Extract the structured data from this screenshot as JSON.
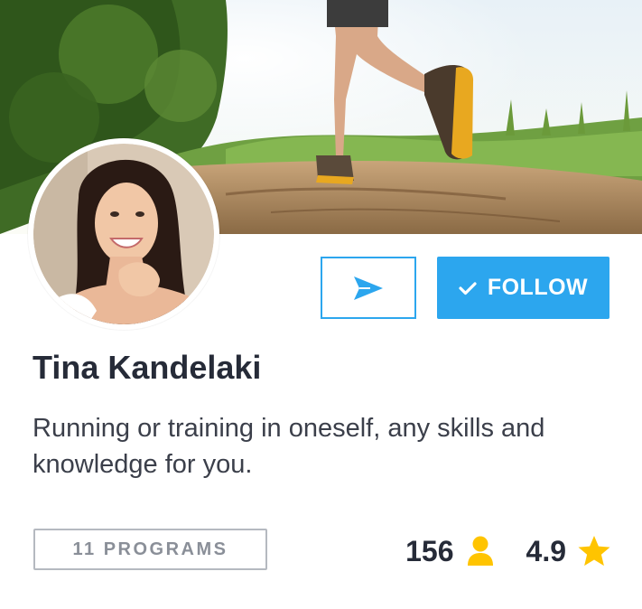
{
  "profile": {
    "name": "Tina Kandelaki",
    "bio": "Running or training in oneself, any skills and knowledge for you."
  },
  "actions": {
    "follow_label": "FOLLOW",
    "send_icon": "paper-plane-icon",
    "follow_icon": "check-icon"
  },
  "programs": {
    "label": "11 PROGRAMS"
  },
  "stats": {
    "followers": "156",
    "followers_icon": "user-icon",
    "rating": "4.9",
    "rating_icon": "star-icon"
  },
  "colors": {
    "accent": "#2CA6EE",
    "icon_yellow": "#FFC400",
    "text_dark": "#262B38",
    "pill_border": "#B5B9C0",
    "pill_text": "#8A8F98"
  }
}
